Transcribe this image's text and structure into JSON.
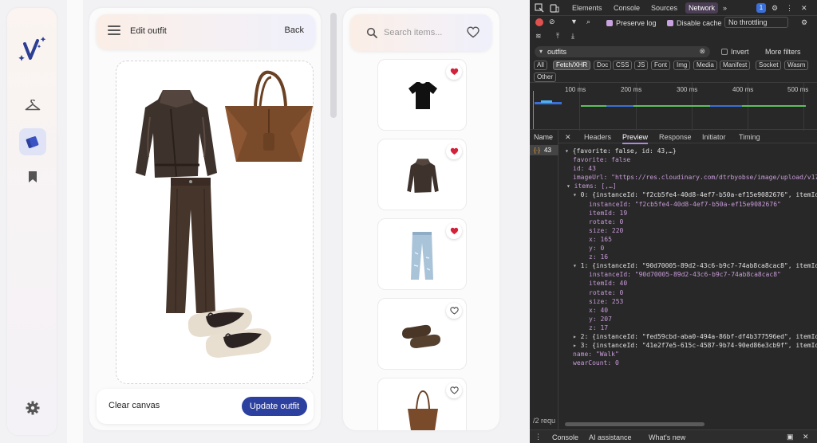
{
  "app": {
    "header_title": "Edit outfit",
    "back_label": "Back",
    "clear_label": "Clear canvas",
    "update_label": "Update outfit",
    "search_placeholder": "Search items...",
    "accent_color": "#2c40a0",
    "heart_color": "#d3213a",
    "item_cards": [
      {
        "name": "black-tshirt",
        "favorite": true,
        "icon": "tshirt-icon"
      },
      {
        "name": "leather-jacket",
        "favorite": true,
        "icon": "jacket-icon"
      },
      {
        "name": "ripped-jeans",
        "favorite": true,
        "icon": "jeans-icon"
      },
      {
        "name": "ballet-flats",
        "favorite": false,
        "icon": "flats-icon"
      },
      {
        "name": "tote-bag",
        "favorite": false,
        "icon": "bag-icon"
      }
    ]
  },
  "devtools": {
    "top_tabs": [
      "Elements",
      "Console",
      "Sources",
      "Network"
    ],
    "badge_count": "1",
    "preserve_log": "Preserve log",
    "disable_cache": "Disable cache",
    "throttle": "No throttling",
    "filter_text": "outfits",
    "invert": "Invert",
    "more_filters": "More filters",
    "chips": [
      "All",
      "Fetch/XHR",
      "Doc",
      "CSS",
      "JS",
      "Font",
      "Img",
      "Media",
      "Manifest",
      "Socket",
      "Wasm",
      "Other"
    ],
    "ticks": [
      "100 ms",
      "200 ms",
      "300 ms",
      "400 ms",
      "500 ms"
    ],
    "name_header": "Name",
    "request_name": "43",
    "detail_tabs": [
      "Headers",
      "Preview",
      "Response",
      "Initiator",
      "Timing"
    ],
    "json_lines": [
      "{favorite: false, id: 43,…}",
      "favorite: false",
      "id: 43",
      "imageUrl: \"https://res.cloudinary.com/dtrbyobse/image/upload/v177",
      "items: [,…]",
      "0: {instanceId: \"f2cb5fe4-40d8-4ef7-b50a-ef15e9082676\", itemId:",
      "instanceId: \"f2cb5fe4-40d8-4ef7-b50a-ef15e9082676\"",
      "itemId: 19",
      "rotate: 0",
      "size: 220",
      "x: 165",
      "y: 0",
      "z: 16",
      "1: {instanceId: \"90d70005-89d2-43c6-b9c7-74ab8ca8cac8\", itemId:",
      "instanceId: \"90d70005-89d2-43c6-b9c7-74ab8ca8cac8\"",
      "itemId: 40",
      "rotate: 0",
      "size: 253",
      "x: 40",
      "y: 207",
      "z: 17",
      "2: {instanceId: \"fed59cbd-aba0-494a-86bf-df4b377596ed\", itemId:",
      "3: {instanceId: \"41e2f7e5-615c-4587-9b74-90ed86e3cb9f\", itemId:",
      "name: \"Walk\"",
      "wearCount: 0"
    ],
    "status_text": "/2 requ",
    "bottom_tabs": [
      "Console",
      "AI assistance",
      "What's new"
    ]
  }
}
